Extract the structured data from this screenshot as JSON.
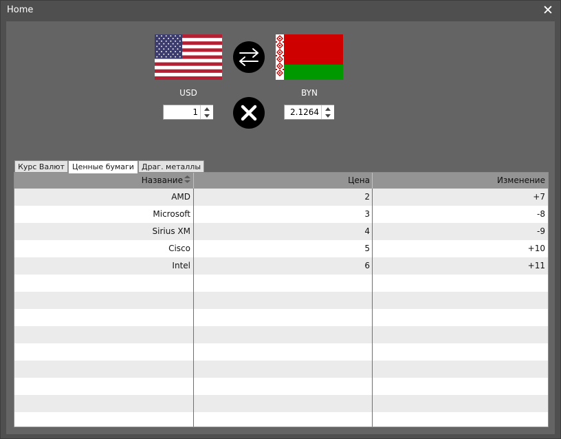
{
  "window": {
    "title": "Home",
    "close_glyph": "✕"
  },
  "converter": {
    "from": {
      "code": "USD",
      "flag": "us-flag-icon",
      "amount": "1"
    },
    "to": {
      "code": "BYN",
      "flag": "belarus-flag-icon",
      "amount": "2.1264"
    },
    "swap_icon": "swap-arrows-icon",
    "clear_icon": "close-circle-icon"
  },
  "tabs": [
    {
      "label": "Курс Валют",
      "active": false
    },
    {
      "label": "Ценные бумаги",
      "active": true
    },
    {
      "label": "Драг. металлы",
      "active": false
    }
  ],
  "table": {
    "columns": [
      "Название",
      "Цена",
      "Изменение"
    ],
    "sort_icon": "sort-arrows-icon",
    "rows": [
      {
        "name": "AMD",
        "price": "2",
        "change": "+7"
      },
      {
        "name": "Microsoft",
        "price": "3",
        "change": "-8"
      },
      {
        "name": "Sirius XM",
        "price": "4",
        "change": "-9"
      },
      {
        "name": "Cisco",
        "price": "5",
        "change": "+10"
      },
      {
        "name": "Intel",
        "price": "6",
        "change": "+11"
      }
    ],
    "empty_rows": 9
  },
  "colors": {
    "window_bg": "#4f4f4f",
    "client_bg": "#646464",
    "header_bg": "#949494",
    "row_alt": "#ebebeb",
    "belarus_red": "#cf0000",
    "belarus_green": "#009a00"
  }
}
